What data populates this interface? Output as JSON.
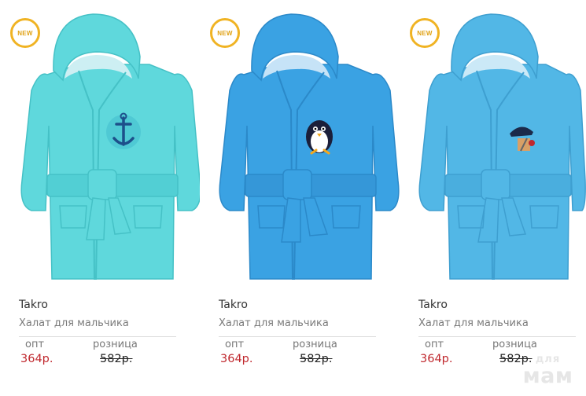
{
  "products": [
    {
      "badge": "NEW",
      "brand": "Takro",
      "title": "Халат для мальчика",
      "price_labels": {
        "wholesale": "опт",
        "retail": "розница"
      },
      "prices": {
        "wholesale": "364р.",
        "retail": "582р."
      },
      "colors": {
        "robe": "#5fd8dc",
        "robe_dark": "#45c1c6",
        "lining": "#cdeff3",
        "patch": "anchor"
      }
    },
    {
      "badge": "NEW",
      "brand": "Takro",
      "title": "Халат для мальчика",
      "price_labels": {
        "wholesale": "опт",
        "retail": "розница"
      },
      "prices": {
        "wholesale": "364р.",
        "retail": "582р."
      },
      "colors": {
        "robe": "#3aa2e3",
        "robe_dark": "#2b89c9",
        "lining": "#c6e3f7",
        "patch": "penguin"
      }
    },
    {
      "badge": "NEW",
      "brand": "Takro",
      "title": "Халат для мальчика",
      "price_labels": {
        "wholesale": "опт",
        "retail": "розница"
      },
      "prices": {
        "wholesale": "364р.",
        "retail": "582р."
      },
      "colors": {
        "robe": "#52b7e6",
        "robe_dark": "#3e9fd0",
        "lining": "#cbe9f7",
        "patch": "pirate"
      }
    }
  ],
  "accent": {
    "badge_ring": "#f0b323",
    "price_red": "#c0282e"
  },
  "watermark": {
    "line1": "для",
    "line2": "мам"
  }
}
